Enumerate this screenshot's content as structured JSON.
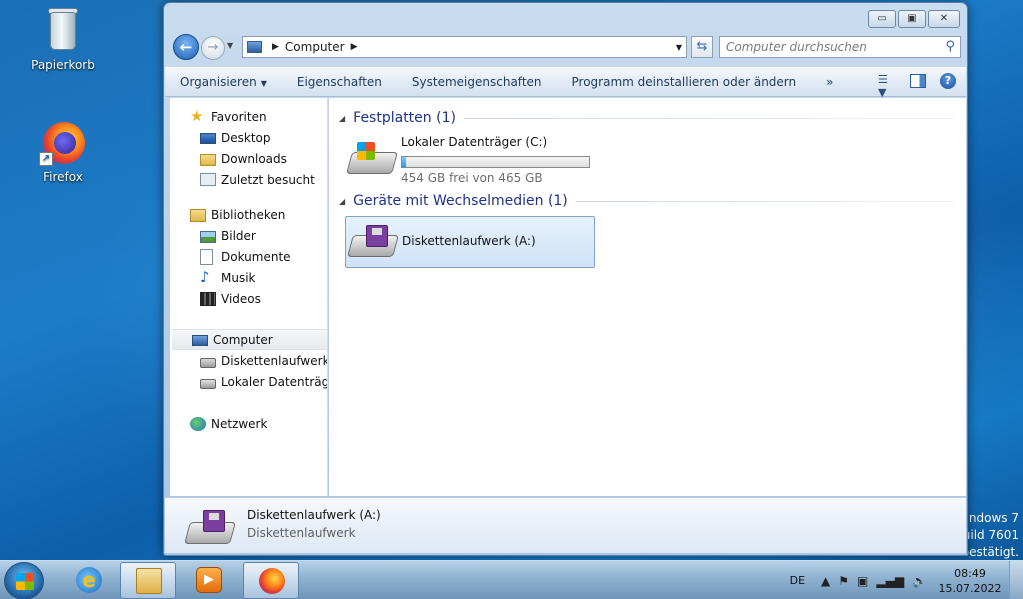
{
  "desktop": {
    "icons": [
      {
        "label": "Papierkorb",
        "icon": "recycle-bin-icon"
      },
      {
        "label": "Firefox",
        "icon": "firefox-icon"
      }
    ],
    "watermark": [
      "Windows 7",
      "Build 7601",
      "bestätigt."
    ]
  },
  "window": {
    "controls": {
      "minimize": "▭",
      "maximize": "▣",
      "close": "✕"
    },
    "address": {
      "location": "Computer"
    },
    "search": {
      "placeholder": "Computer durchsuchen"
    },
    "toolbar": {
      "organize": "Organisieren",
      "properties": "Eigenschaften",
      "system_properties": "Systemeigenschaften",
      "uninstall": "Programm deinstallieren oder ändern",
      "more": "»"
    },
    "nav": {
      "favorites": {
        "label": "Favoriten",
        "items": [
          "Desktop",
          "Downloads",
          "Zuletzt besucht"
        ]
      },
      "libraries": {
        "label": "Bibliotheken",
        "items": [
          "Bilder",
          "Dokumente",
          "Musik",
          "Videos"
        ]
      },
      "computer": {
        "label": "Computer",
        "items": [
          "Diskettenlaufwerk (A:)",
          "Lokaler Datenträger (C:)"
        ]
      },
      "network": {
        "label": "Netzwerk"
      }
    },
    "content": {
      "hard_disks": {
        "heading": "Festplatten (1)",
        "drive": {
          "name": "Lokaler Datenträger (C:)",
          "free_text": "454 GB frei von 465 GB",
          "used_fraction": 0.024
        }
      },
      "removable": {
        "heading": "Geräte mit Wechselmedien (1)",
        "drive": {
          "name": "Diskettenlaufwerk (A:)"
        }
      }
    },
    "details": {
      "title": "Diskettenlaufwerk (A:)",
      "subtitle": "Diskettenlaufwerk"
    }
  },
  "taskbar": {
    "language": "DE",
    "time": "08:49",
    "date": "15.07.2022"
  }
}
